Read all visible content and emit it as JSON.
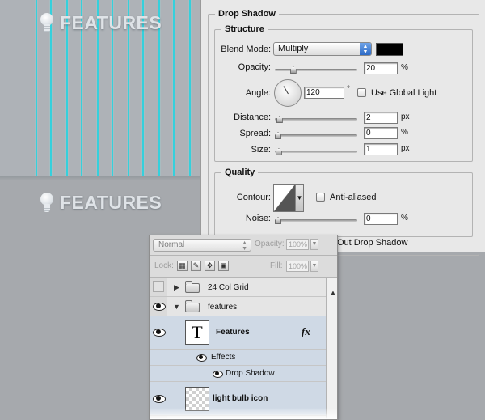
{
  "canvas": {
    "feature_text_top": "FEATURES",
    "feature_text_bottom": "FEATURES",
    "guide_color": "#35d0dc"
  },
  "dialog": {
    "title": "Drop Shadow",
    "structure_legend": "Structure",
    "blend_mode_label": "Blend Mode:",
    "blend_mode_value": "Multiply",
    "shadow_color": "#000000",
    "opacity_label": "Opacity:",
    "opacity_value": "20",
    "opacity_unit": "%",
    "angle_label": "Angle:",
    "angle_value": "120",
    "angle_unit": "°",
    "global_light_label": "Use Global Light",
    "distance_label": "Distance:",
    "distance_value": "2",
    "distance_unit": "px",
    "spread_label": "Spread:",
    "spread_value": "0",
    "spread_unit": "%",
    "size_label": "Size:",
    "size_value": "1",
    "size_unit": "px",
    "quality_legend": "Quality",
    "contour_label": "Contour:",
    "anti_aliased_label": "Anti-aliased",
    "noise_label": "Noise:",
    "noise_value": "0",
    "noise_unit": "%",
    "knockout_label": "Out Drop Shadow",
    "opacity_level": 0.2,
    "distance_level": 0.02,
    "spread_level": 0,
    "size_level": 0.01,
    "noise_level": 0
  },
  "layers_panel": {
    "blend_mode": "Normal",
    "opacity_label": "Opacity:",
    "opacity_value": "100%",
    "lock_label": "Lock:",
    "fill_label": "Fill:",
    "fill_value": "100%",
    "layers": [
      {
        "name": "24 Col Grid"
      },
      {
        "name": "features"
      },
      {
        "name": "Features",
        "thumb": "T",
        "fx": "fx"
      },
      {
        "name": "Effects"
      },
      {
        "name": "Drop Shadow"
      },
      {
        "name": "light bulb icon"
      }
    ]
  }
}
